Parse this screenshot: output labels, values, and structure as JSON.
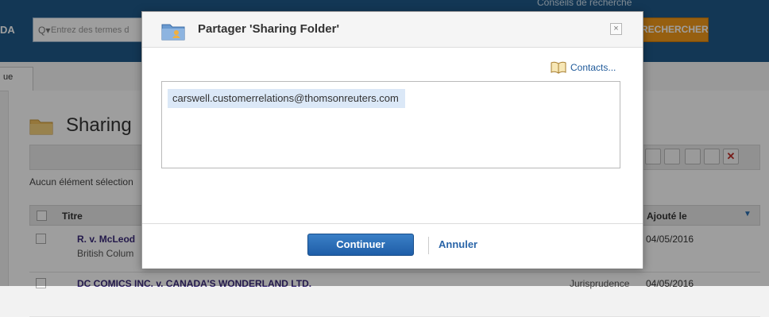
{
  "app": {
    "brand": "DA",
    "search_icon": "Q▾",
    "search_placeholder": "Entrez des termes d",
    "search_hint": "Conseils de recherche",
    "search_button": "RECHERCHER",
    "subtab_label": "ue"
  },
  "folder": {
    "title": "Sharing",
    "selection_status": "Aucun élément sélection"
  },
  "table": {
    "col_title": "Titre",
    "col_added": "Ajouté le",
    "rows": [
      {
        "title": "R. v. McLeod",
        "subtitle": "British Colum",
        "type": "",
        "date": "04/05/2016"
      },
      {
        "title": "DC COMICS INC. v. CANADA'S WONDERLAND LTD.",
        "subtitle": "",
        "type": "Jurisprudence",
        "date": "04/05/2016"
      }
    ]
  },
  "dialog": {
    "title": "Partager 'Sharing Folder'",
    "close_label": "×",
    "contacts_label": "Contacts...",
    "recipient": "carswell.customerrelations@thomsonreuters.com",
    "continue_label": "Continuer",
    "cancel_label": "Annuler"
  },
  "colors": {
    "topbar": "#1f5a8a",
    "accent": "#f29a1a",
    "primary_button": "#1f5ea8",
    "chip": "#dbe8f7"
  }
}
